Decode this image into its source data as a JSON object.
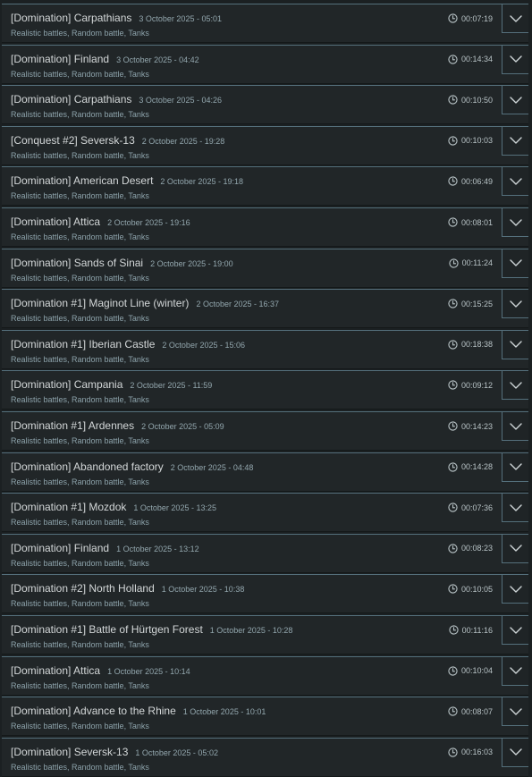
{
  "battles": [
    {
      "title": "[Domination] Carpathians",
      "date": "3 October 2025 - 05:01",
      "subtitle": "Realistic battles, Random battle, Tanks",
      "duration": "00:07:19",
      "icon": "clock-icon",
      "expand_icon": "chevron-down-icon"
    },
    {
      "title": "[Domination] Finland",
      "date": "3 October 2025 - 04:42",
      "subtitle": "Realistic battles, Random battle, Tanks",
      "duration": "00:14:34",
      "icon": "clock-icon",
      "expand_icon": "chevron-down-icon"
    },
    {
      "title": "[Domination] Carpathians",
      "date": "3 October 2025 - 04:26",
      "subtitle": "Realistic battles, Random battle, Tanks",
      "duration": "00:10:50",
      "icon": "clock-icon",
      "expand_icon": "chevron-down-icon"
    },
    {
      "title": "[Conquest #2] Seversk-13",
      "date": "2 October 2025 - 19:28",
      "subtitle": "Realistic battles, Random battle, Tanks",
      "duration": "00:10:03",
      "icon": "clock-icon",
      "expand_icon": "chevron-down-icon"
    },
    {
      "title": "[Domination] American Desert",
      "date": "2 October 2025 - 19:18",
      "subtitle": "Realistic battles, Random battle, Tanks",
      "duration": "00:06:49",
      "icon": "clock-icon",
      "expand_icon": "chevron-down-icon"
    },
    {
      "title": "[Domination] Attica",
      "date": "2 October 2025 - 19:16",
      "subtitle": "Realistic battles, Random battle, Tanks",
      "duration": "00:08:01",
      "icon": "clock-icon",
      "expand_icon": "chevron-down-icon"
    },
    {
      "title": "[Domination] Sands of Sinai",
      "date": "2 October 2025 - 19:00",
      "subtitle": "Realistic battles, Random battle, Tanks",
      "duration": "00:11:24",
      "icon": "clock-icon",
      "expand_icon": "chevron-down-icon"
    },
    {
      "title": "[Domination #1] Maginot Line (winter)",
      "date": "2 October 2025 - 16:37",
      "subtitle": "Realistic battles, Random battle, Tanks",
      "duration": "00:15:25",
      "icon": "clock-icon",
      "expand_icon": "chevron-down-icon"
    },
    {
      "title": "[Domination #1] Iberian Castle",
      "date": "2 October 2025 - 15:06",
      "subtitle": "Realistic battles, Random battle, Tanks",
      "duration": "00:18:38",
      "icon": "clock-icon",
      "expand_icon": "chevron-down-icon"
    },
    {
      "title": "[Domination] Campania",
      "date": "2 October 2025 - 11:59",
      "subtitle": "Realistic battles, Random battle, Tanks",
      "duration": "00:09:12",
      "icon": "clock-icon",
      "expand_icon": "chevron-down-icon"
    },
    {
      "title": "[Domination #1] Ardennes",
      "date": "2 October 2025 - 05:09",
      "subtitle": "Realistic battles, Random battle, Tanks",
      "duration": "00:14:23",
      "icon": "clock-icon",
      "expand_icon": "chevron-down-icon"
    },
    {
      "title": "[Domination] Abandoned factory",
      "date": "2 October 2025 - 04:48",
      "subtitle": "Realistic battles, Random battle, Tanks",
      "duration": "00:14:28",
      "icon": "clock-icon",
      "expand_icon": "chevron-down-icon"
    },
    {
      "title": "[Domination #1] Mozdok",
      "date": "1 October 2025 - 13:25",
      "subtitle": "Realistic battles, Random battle, Tanks",
      "duration": "00:07:36",
      "icon": "clock-icon",
      "expand_icon": "chevron-down-icon"
    },
    {
      "title": "[Domination] Finland",
      "date": "1 October 2025 - 13:12",
      "subtitle": "Realistic battles, Random battle, Tanks",
      "duration": "00:08:23",
      "icon": "clock-icon",
      "expand_icon": "chevron-down-icon"
    },
    {
      "title": "[Domination #2] North Holland",
      "date": "1 October 2025 - 10:38",
      "subtitle": "Realistic battles, Random battle, Tanks",
      "duration": "00:10:05",
      "icon": "clock-icon",
      "expand_icon": "chevron-down-icon"
    },
    {
      "title": "[Domination #1] Battle of Hürtgen Forest",
      "date": "1 October 2025 - 10:28",
      "subtitle": "Realistic battles, Random battle, Tanks",
      "duration": "00:11:16",
      "icon": "clock-icon",
      "expand_icon": "chevron-down-icon"
    },
    {
      "title": "[Domination] Attica",
      "date": "1 October 2025 - 10:14",
      "subtitle": "Realistic battles, Random battle, Tanks",
      "duration": "00:10:04",
      "icon": "clock-icon",
      "expand_icon": "chevron-down-icon"
    },
    {
      "title": "[Domination] Advance to the Rhine",
      "date": "1 October 2025 - 10:01",
      "subtitle": "Realistic battles, Random battle, Tanks",
      "duration": "00:08:07",
      "icon": "clock-icon",
      "expand_icon": "chevron-down-icon"
    },
    {
      "title": "[Domination] Seversk-13",
      "date": "1 October 2025 - 05:02",
      "subtitle": "Realistic battles, Random battle, Tanks",
      "duration": "00:16:03",
      "icon": "clock-icon",
      "expand_icon": "chevron-down-icon"
    }
  ],
  "colors": {
    "background": "#1b2022",
    "row_background": "#212628",
    "border_accent": "#55707c",
    "title_text": "#d3d7d8",
    "meta_text": "#8da3ab"
  }
}
